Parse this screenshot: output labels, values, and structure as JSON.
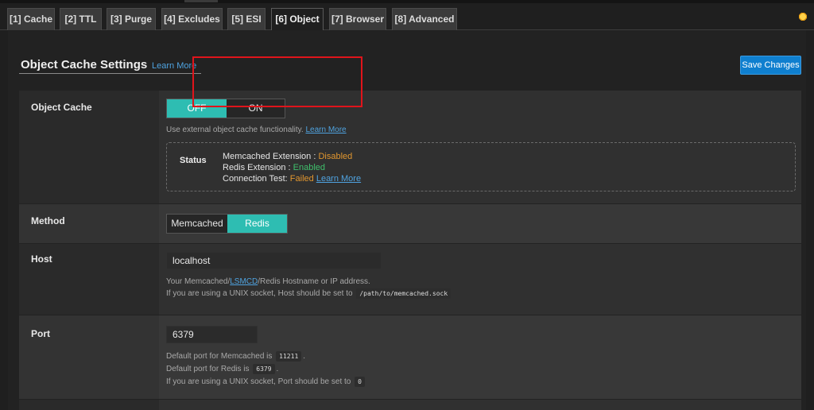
{
  "tabs": [
    {
      "label": "[1] Cache",
      "active": false
    },
    {
      "label": "[2] TTL",
      "active": false
    },
    {
      "label": "[3] Purge",
      "active": false
    },
    {
      "label": "[4] Excludes",
      "active": false
    },
    {
      "label": "[5] ESI",
      "active": false
    },
    {
      "label": "[6] Object",
      "active": true
    },
    {
      "label": "[7] Browser",
      "active": false
    },
    {
      "label": "[8] Advanced",
      "active": false
    }
  ],
  "header": {
    "title": "Object Cache Settings",
    "learn_more": "Learn More",
    "save_label": "Save Changes"
  },
  "object_cache": {
    "label": "Object Cache",
    "off_label": "OFF",
    "on_label": "ON",
    "selected": "OFF",
    "desc": "Use external object cache functionality.",
    "desc_link": "Learn More",
    "status": {
      "label": "Status",
      "memcached_label": "Memcached Extension : ",
      "memcached_value": "Disabled",
      "redis_label": "Redis Extension : ",
      "redis_value": "Enabled",
      "connection_label": "Connection Test: ",
      "connection_value": "Failed",
      "connection_link": "Learn More"
    }
  },
  "method": {
    "label": "Method",
    "memcached_label": "Memcached",
    "redis_label": "Redis",
    "selected": "Redis"
  },
  "host": {
    "label": "Host",
    "value": "localhost",
    "desc_pre": "Your Memcached/",
    "desc_link": "LSMCD",
    "desc_post": "/Redis Hostname or IP address.",
    "desc2": "If you are using a UNIX socket, Host should be set to",
    "socket_code": "/path/to/memcached.sock"
  },
  "port": {
    "label": "Port",
    "value": "6379",
    "line1": "Default port for Memcached is",
    "code1": "11211",
    "line2": "Default port for Redis is",
    "code2": "6379",
    "line3": "If you are using a UNIX socket, Port should be set to",
    "code3": "0"
  },
  "colors": {
    "accent_teal": "#2ebdb2",
    "save_blue": "#0f7fcf",
    "link_blue": "#4fa3e0",
    "orange_status": "#e0962f",
    "green_status": "#3fbf6b",
    "highlight_red": "#e0141b"
  }
}
